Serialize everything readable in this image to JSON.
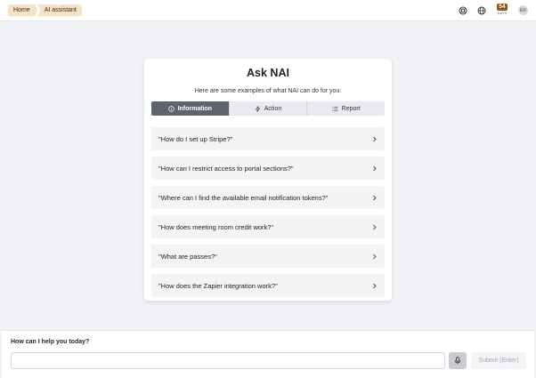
{
  "breadcrumb": [
    "Home",
    "AI assistant"
  ],
  "topbar": {
    "icons": [
      "help-lifebuoy-icon",
      "globe-icon"
    ],
    "days_left": "54",
    "days_label": "DAYS",
    "avatar_initials": "ER"
  },
  "card": {
    "title": "Ask NAI",
    "subtitle": "Here are some examples of what NAI can do for you:",
    "tabs": [
      {
        "label": "Information",
        "icon": "info-icon",
        "active": true
      },
      {
        "label": "Action",
        "icon": "lightning-icon",
        "active": false
      },
      {
        "label": "Report",
        "icon": "list-icon",
        "active": false
      }
    ],
    "examples": [
      "\"How do I set up Stripe?\"",
      "\"How can I restrict access to portal sections?\"",
      "\"Where can I find the available email notification tokens?\"",
      "\"How does meeting room credit work?\"",
      "\"What are passes?\"",
      "\"How does the Zapier integration work?\""
    ]
  },
  "prompt": {
    "label": "How can I help you today?",
    "value": "",
    "placeholder": "",
    "submit_label": "Submit (Enter)"
  },
  "colors": {
    "accent": "#5d6470",
    "breadcrumb_bg": "#f6e3c7",
    "badge": "#8a5a15",
    "page_bg": "#f1f2f6"
  }
}
